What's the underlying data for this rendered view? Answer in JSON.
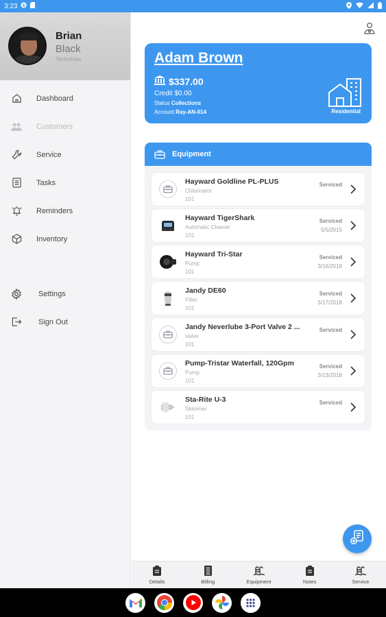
{
  "status_bar": {
    "time": "3:23"
  },
  "drawer": {
    "user": {
      "first_name": "Brian",
      "last_name": "Black",
      "role": "Technician"
    },
    "items": [
      {
        "label": "Dashboard",
        "icon": "home-icon"
      },
      {
        "label": "Customers",
        "icon": "people-icon"
      },
      {
        "label": "Service",
        "icon": "wrench-icon"
      },
      {
        "label": "Tasks",
        "icon": "tasks-icon"
      },
      {
        "label": "Reminders",
        "icon": "alarm-icon"
      },
      {
        "label": "Inventory",
        "icon": "box-icon"
      }
    ],
    "secondary_items": [
      {
        "label": "Settings",
        "icon": "gear-icon"
      },
      {
        "label": "Sign Out",
        "icon": "sign-out-icon"
      }
    ]
  },
  "customer": {
    "name": "Adam Brown",
    "balance": "$337.00",
    "credit": "Credit $0.00",
    "status_label": "Status",
    "status_value": "Collections",
    "account_label": "Account",
    "account_value": "Ray-AN-014",
    "property_type": "Residential"
  },
  "equipment": {
    "title": "Equipment",
    "items": [
      {
        "name": "Hayward Goldline PL-PLUS",
        "type": "Chlorinator",
        "number": "101",
        "status": "Serviced",
        "date": "",
        "thumb": "placeholder"
      },
      {
        "name": "Hayward TigerShark",
        "type": "Automatic Cleaner",
        "number": "101",
        "status": "Serviced",
        "date": "5/5/2015",
        "thumb": "cleaner"
      },
      {
        "name": "Hayward Tri-Star",
        "type": "Pump",
        "number": "101",
        "status": "Serviced",
        "date": "3/16/2018",
        "thumb": "pump"
      },
      {
        "name": "Jandy DE60",
        "type": "Filter",
        "number": "101",
        "status": "Serviced",
        "date": "3/17/2018",
        "thumb": "filter"
      },
      {
        "name": "Jandy Neverlube 3-Port Valve 2 ...",
        "type": "Valve",
        "number": "101",
        "status": "Serviced",
        "date": "",
        "thumb": "placeholder"
      },
      {
        "name": "Pump-Tristar Waterfall, 120Gpm",
        "type": "Pump",
        "number": "101",
        "status": "Serviced",
        "date": "3/13/2018",
        "thumb": "placeholder"
      },
      {
        "name": "Sta-Rite U-3",
        "type": "Skimmer",
        "number": "101",
        "status": "Serviced",
        "date": "",
        "thumb": "skimmer"
      }
    ]
  },
  "bottom_tabs": [
    {
      "label": "Details",
      "icon": "clipboard-icon"
    },
    {
      "label": "Billing",
      "icon": "billing-icon"
    },
    {
      "label": "Equipment",
      "icon": "pool-ladder-icon"
    },
    {
      "label": "Notes",
      "icon": "notes-icon"
    },
    {
      "label": "Service",
      "icon": "pool-ladder-icon"
    }
  ],
  "system_apps": [
    {
      "name": "gmail-icon"
    },
    {
      "name": "chrome-icon"
    },
    {
      "name": "youtube-icon"
    },
    {
      "name": "photos-icon"
    },
    {
      "name": "app-drawer-icon"
    }
  ],
  "colors": {
    "accent": "#3d97ef",
    "drawer_bg": "#f4f4f6"
  }
}
